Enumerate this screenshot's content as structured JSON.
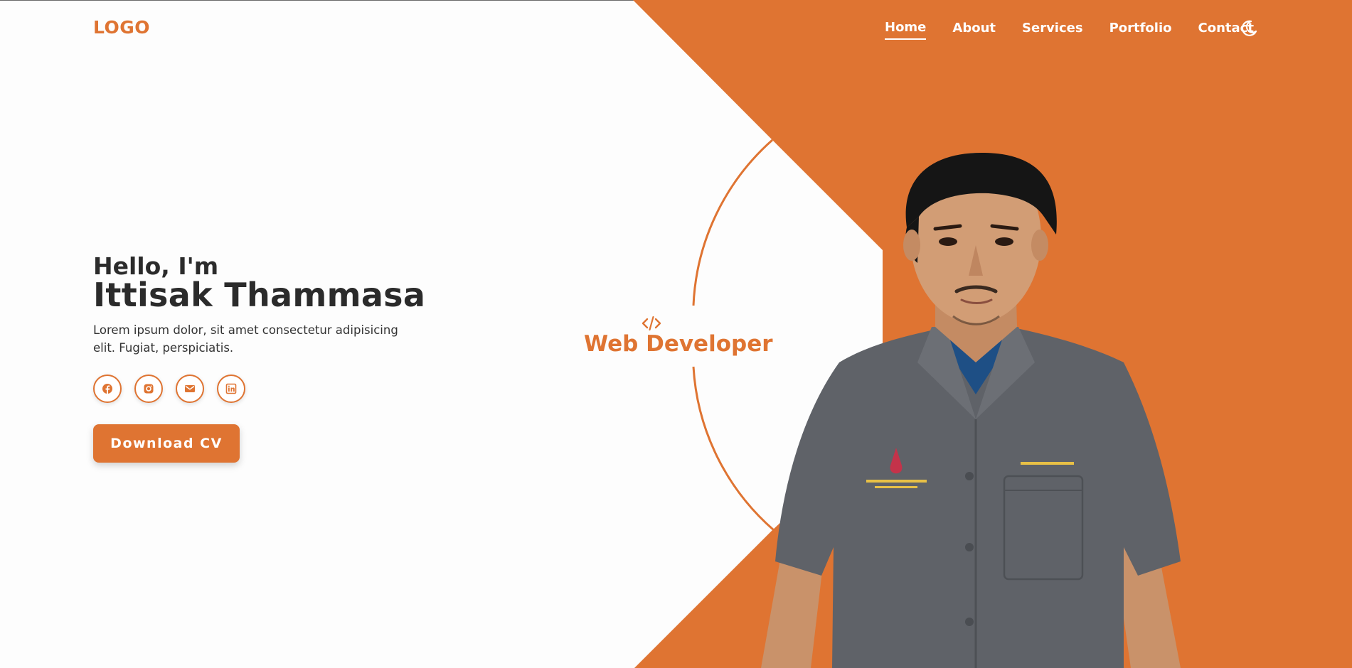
{
  "header": {
    "logo": "LOGO",
    "nav": [
      {
        "label": "Home",
        "active": true
      },
      {
        "label": "About",
        "active": false
      },
      {
        "label": "Services",
        "active": false
      },
      {
        "label": "Portfolio",
        "active": false
      },
      {
        "label": "Contact",
        "active": false
      }
    ],
    "theme_icon": "moon-icon"
  },
  "hero": {
    "greeting": "Hello, I'm",
    "name": "Ittisak Thammasa",
    "description": "Lorem ipsum dolor, sit amet consectetur adipisicing elit. Fugiat, perspiciatis.",
    "socials": [
      "facebook-icon",
      "instagram-icon",
      "mail-icon",
      "linkedin-icon"
    ],
    "cta_label": "Download CV",
    "role_icon": "code-icon",
    "role": "Web Developer"
  },
  "colors": {
    "accent": "#df7432",
    "text": "#2b2b2b",
    "background": "#fdfdfd",
    "shirt": "#5f6268"
  }
}
